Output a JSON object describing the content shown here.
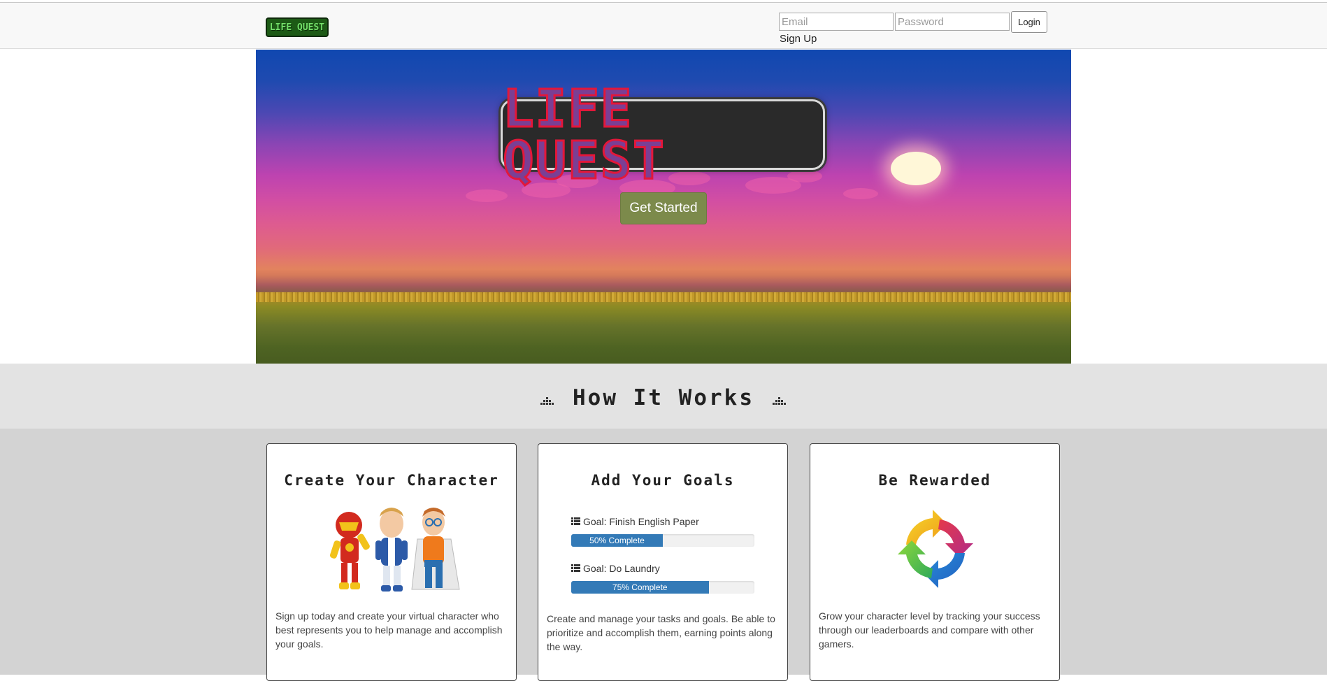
{
  "navbar": {
    "brand_text": "LIFE QUEST",
    "email_placeholder": "Email",
    "password_placeholder": "Password",
    "login_label": "Login",
    "signup_label": "Sign Up"
  },
  "hero": {
    "logo_text": "LIFE QUEST",
    "cta_label": "Get Started"
  },
  "how_it_works": {
    "title": "How It Works"
  },
  "cards": [
    {
      "title": "Create Your Character",
      "text": "Sign up today and create your virtual character who best represents you to help manage and accomplish your goals."
    },
    {
      "title": "Add Your Goals",
      "goals": [
        {
          "label": "Goal: Finish English Paper",
          "progress_text": "50% Complete",
          "progress": 0.5
        },
        {
          "label": "Goal: Do Laundry",
          "progress_text": "75% Complete",
          "progress": 0.75
        }
      ],
      "text": "Create and manage your tasks and goals. Be able to prioritize and accomplish them, earning points along the way."
    },
    {
      "title": "Be Rewarded",
      "text": "Grow your character level by tracking your success through our leaderboards and compare with other gamers."
    }
  ],
  "colors": {
    "cta": "#7c8a4b",
    "progress": "#337ab7",
    "how_band": "#e3e3e3",
    "cards_bg": "#d3d3d3"
  },
  "icons": [
    "life-quest-logo",
    "equalizer-icon",
    "tasks-icon",
    "refresh-arrows-icon",
    "superheroes-illustration"
  ]
}
